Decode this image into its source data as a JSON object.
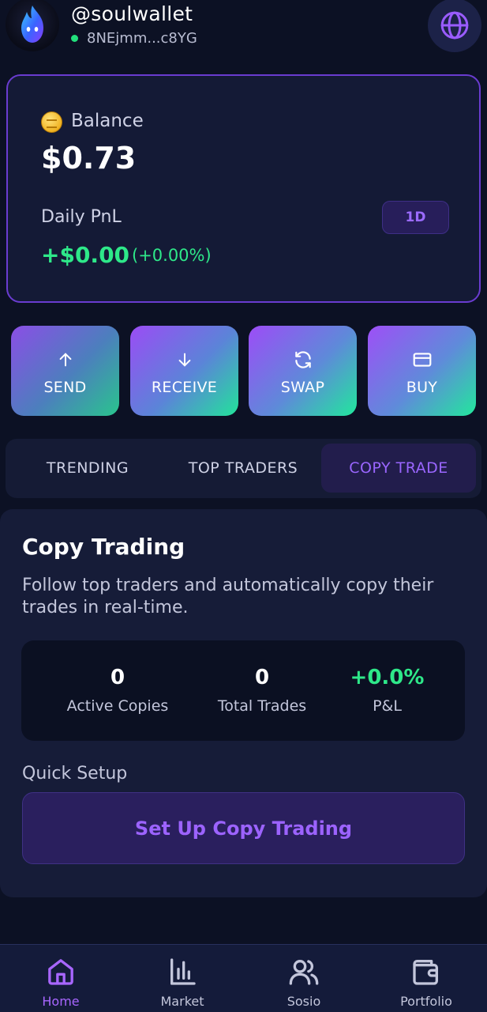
{
  "header": {
    "username": "@soulwallet",
    "address": "8NEjmm...c8YG",
    "avatar_icon": "flame-ghost-icon",
    "language_icon": "globe-icon"
  },
  "balance_card": {
    "coin_icon": "coin-icon",
    "balance_label": "Balance",
    "balance_value": "$0.73",
    "pnl_label": "Daily PnL",
    "period": "1D",
    "pnl_value": "+$0.00",
    "pnl_percent": "(+0.00%)"
  },
  "actions": [
    {
      "label": "SEND",
      "icon": "arrow-up-icon"
    },
    {
      "label": "RECEIVE",
      "icon": "arrow-down-icon"
    },
    {
      "label": "SWAP",
      "icon": "refresh-icon"
    },
    {
      "label": "BUY",
      "icon": "credit-card-icon"
    }
  ],
  "tabs": [
    {
      "label": "TRENDING",
      "active": false
    },
    {
      "label": "TOP TRADERS",
      "active": false
    },
    {
      "label": "COPY TRADE",
      "active": true
    }
  ],
  "copy_trading": {
    "title": "Copy Trading",
    "description": "Follow top traders and automatically copy their trades in real-time.",
    "stats": [
      {
        "value": "0",
        "label": "Active Copies"
      },
      {
        "value": "0",
        "label": "Total Trades"
      },
      {
        "value": "+0.0%",
        "label": "P&L"
      }
    ],
    "quick_setup_label": "Quick Setup",
    "setup_button": "Set Up Copy Trading"
  },
  "bottom_nav": [
    {
      "label": "Home",
      "icon": "home-icon",
      "active": true
    },
    {
      "label": "Market",
      "icon": "bar-chart-icon",
      "active": false
    },
    {
      "label": "Sosio",
      "icon": "users-icon",
      "active": false
    },
    {
      "label": "Portfolio",
      "icon": "wallet-icon",
      "active": false
    }
  ],
  "colors": {
    "background": "#0c1124",
    "accent_purple": "#9c63ff",
    "positive_green": "#2ee889",
    "card_border": "#6a3cd0"
  }
}
